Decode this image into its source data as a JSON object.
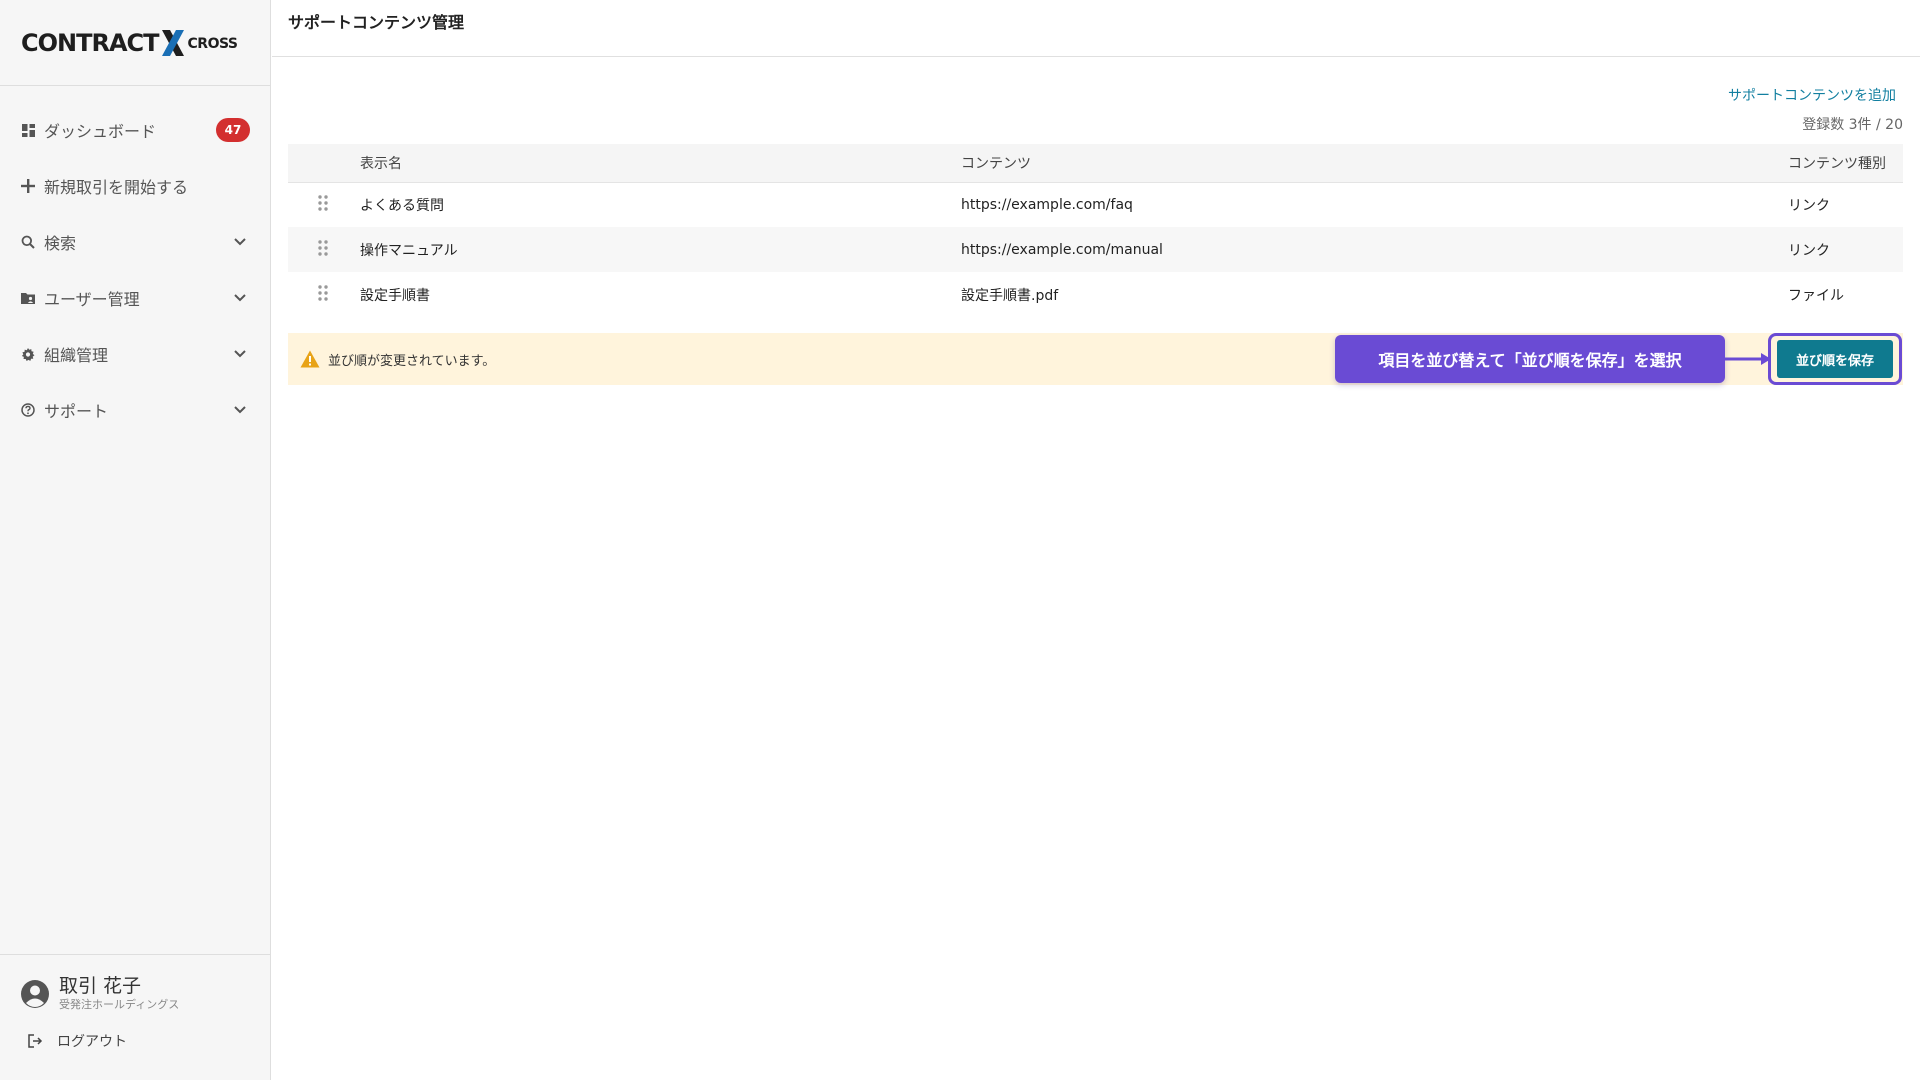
{
  "brand": {
    "logo_main": "CONTRACT",
    "logo_x": "X",
    "logo_sub": "CROSS"
  },
  "sidebar": {
    "items": [
      {
        "label": "ダッシュボード",
        "icon": "dashboard-icon",
        "badge": "47"
      },
      {
        "label": "新規取引を開始する",
        "icon": "plus-icon"
      },
      {
        "label": "検索",
        "icon": "search-icon",
        "expandable": true
      },
      {
        "label": "ユーザー管理",
        "icon": "folder-user-icon",
        "expandable": true
      },
      {
        "label": "組織管理",
        "icon": "gear-icon",
        "expandable": true
      },
      {
        "label": "サポート",
        "icon": "help-circle-icon",
        "expandable": true
      }
    ],
    "user": {
      "name": "取引 花子",
      "org": "受発注ホールディングス"
    },
    "logout_label": "ログアウト"
  },
  "header": {
    "title": "サポートコンテンツ管理"
  },
  "main": {
    "add_link": "サポートコンテンツを追加",
    "count_text": "登録数 3件 / 20",
    "table": {
      "columns": [
        "表示名",
        "コンテンツ",
        "コンテンツ種別"
      ],
      "rows": [
        {
          "name": "よくある質問",
          "content": "https://example.com/faq",
          "type": "リンク"
        },
        {
          "name": "操作マニュアル",
          "content": "https://example.com/manual",
          "type": "リンク"
        },
        {
          "name": "設定手順書",
          "content": "設定手順書.pdf",
          "type": "ファイル"
        }
      ]
    },
    "notice": {
      "text": "並び順が変更されています。"
    },
    "save_button": "並び順を保存",
    "callout": "項目を並び替えて「並び順を保存」を選択"
  },
  "colors": {
    "accent": "#0f7a8f",
    "link": "#127fa0",
    "badge": "#d32f2f",
    "callout": "#6a4bd4",
    "notice_bg": "#fff4dc"
  }
}
